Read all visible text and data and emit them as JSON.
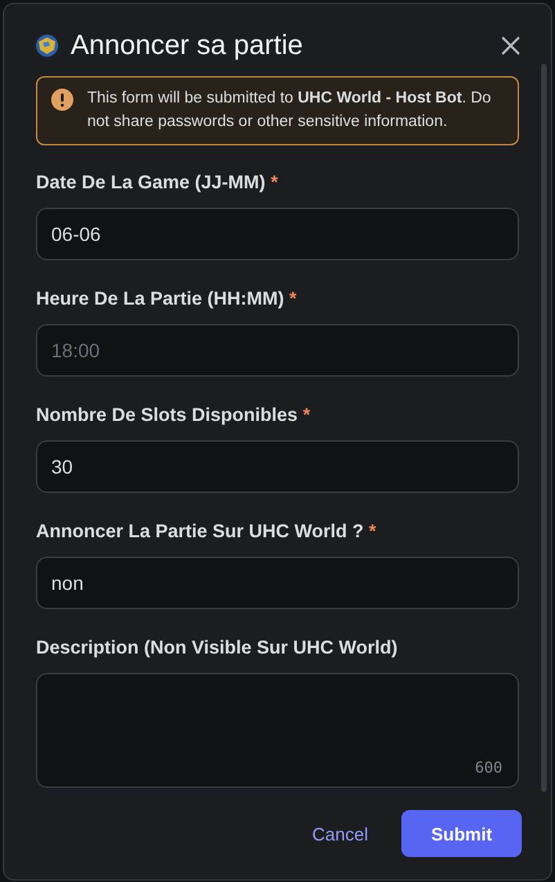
{
  "dialog": {
    "title": "Annoncer sa partie"
  },
  "notice": {
    "text": "This form will be submitted to **UHC World - Host Bot**. Do not share passwords or other sensitive information."
  },
  "fields": [
    {
      "kind": "input",
      "label": "Date De La Game (JJ-MM)",
      "required_mark": "*",
      "value": "06-06"
    },
    {
      "kind": "input",
      "label": "Heure De La Partie (HH:MM)",
      "required_mark": "*",
      "placeholder": "18:00"
    },
    {
      "kind": "input",
      "label": "Nombre De Slots Disponibles",
      "required_mark": "*",
      "value": "30"
    },
    {
      "kind": "input",
      "label": "Annoncer La Partie Sur UHC World ?",
      "required_mark": "*",
      "value": "non"
    },
    {
      "kind": "textarea",
      "label": "Description (Non Visible Sur UHC World)",
      "counter": "600"
    }
  ],
  "buttons": [
    {
      "kind": "link",
      "label": "Cancel"
    },
    {
      "kind": "primary",
      "label": "Submit"
    }
  ]
}
